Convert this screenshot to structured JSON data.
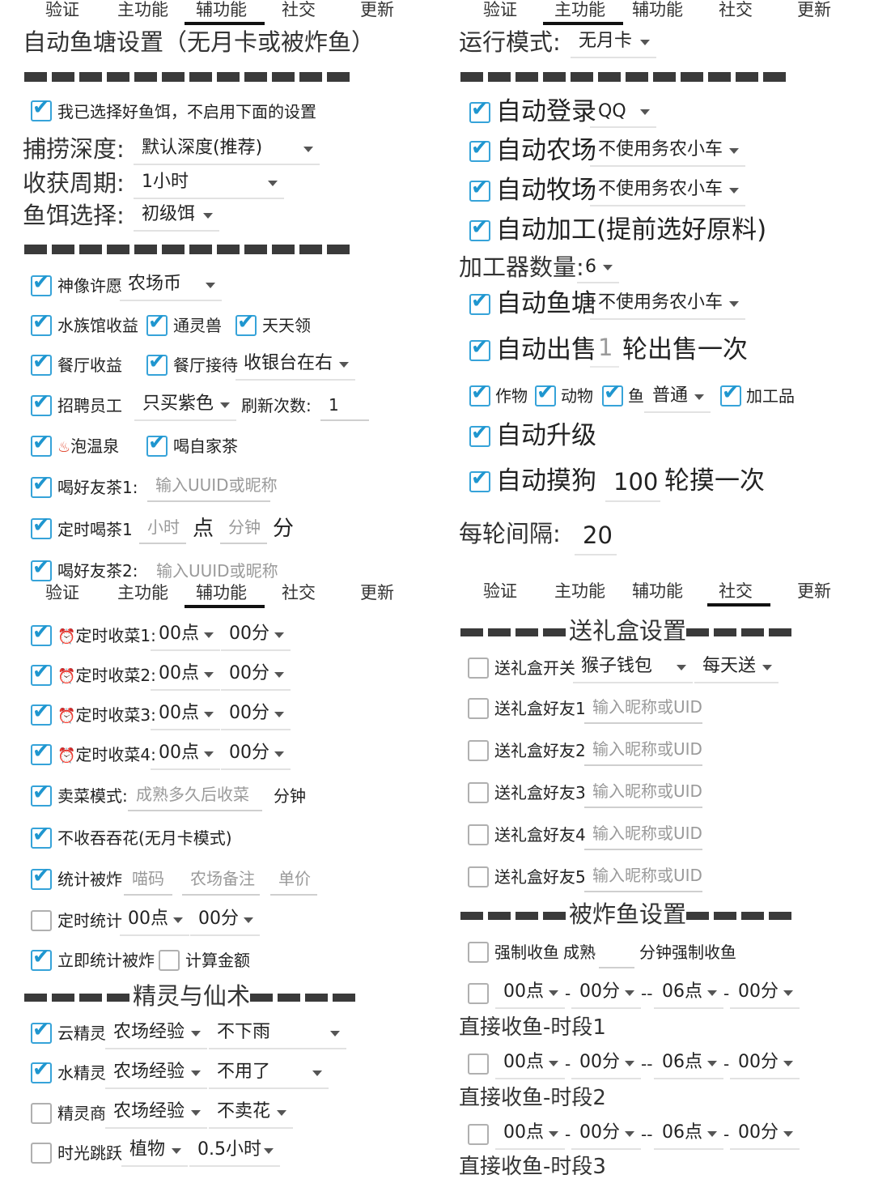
{
  "tabs": {
    "verify": "验证",
    "main": "主功能",
    "aux": "辅功能",
    "social": "社交",
    "update": "更新"
  },
  "fish": {
    "title": "自动鱼塘设置（无月卡或被炸鱼）",
    "skip_bait": "我已选择好鱼饵，不启用下面的设置",
    "depth_label": "捕捞深度:",
    "depth_value": "默认深度(推荐)",
    "cycle_label": "收获周期:",
    "cycle_value": "1小时",
    "bait_label": "鱼饵选择:",
    "bait_value": "初级饵"
  },
  "aux": {
    "wish_label": "神像许愿",
    "wish_value": "农场币",
    "aquarium": "水族馆收益",
    "spirit_beast": "通灵兽",
    "daily": "天天领",
    "restaurant": "餐厅收益",
    "reception": "餐厅接待",
    "reception_value": "收银台在右",
    "hire": "招聘员工",
    "hire_value": "只买紫色",
    "refresh_label": "刷新次数:",
    "refresh_value": "1",
    "hotspring_icon": "♨",
    "hotspring": "泡温泉",
    "own_tea": "喝自家茶",
    "friend_tea1": "喝好友茶1:",
    "friend_tea1_ph": "输入UUID或昵称",
    "timed_tea": "定时喝茶1",
    "hour_ph": "小时",
    "dian": "点",
    "minute_ph": "分钟",
    "fen": "分",
    "friend_tea2": "喝好友茶2:",
    "friend_tea2_ph": "输入UUID或昵称"
  },
  "harvest": {
    "alarm_icon": "⏰",
    "items": [
      {
        "label": "定时收菜1:",
        "hour": "00点",
        "minute": "00分"
      },
      {
        "label": "定时收菜2:",
        "hour": "00点",
        "minute": "00分"
      },
      {
        "label": "定时收菜3:",
        "hour": "00点",
        "minute": "00分"
      },
      {
        "label": "定时收菜4:",
        "hour": "00点",
        "minute": "00分"
      }
    ],
    "sell_mode": "卖菜模式:",
    "sell_ph": "成熟多久后收菜",
    "sell_unit": "分钟",
    "no_flower": "不收吞吞花(无月卡模式)",
    "stat_label": "统计被炸",
    "stat_ph1": "喵码",
    "stat_ph2": "农场备注",
    "stat_ph3": "单价",
    "timed_stat": "定时统计",
    "timed_stat_hour": "00点",
    "timed_stat_minute": "00分",
    "now_stat": "立即统计被炸",
    "calc_amount": "计算金额"
  },
  "spirit": {
    "header": "精灵与仙术",
    "cloud": "云精灵",
    "cloud_v1": "农场经验",
    "cloud_v2": "不下雨",
    "water": "水精灵",
    "water_v1": "农场经验",
    "water_v2": "不用了",
    "merchant": "精灵商",
    "merchant_v1": "农场经验",
    "merchant_v2": "不卖花",
    "jump": "时光跳跃",
    "jump_v1": "植物",
    "jump_v2": "0.5小时"
  },
  "main": {
    "mode_label": "运行模式:",
    "mode_value": "无月卡",
    "login": "自动登录",
    "login_value": "QQ",
    "farm": "自动农场",
    "farm_value": "不使用务农小车",
    "ranch": "自动牧场",
    "ranch_value": "不使用务农小车",
    "process": "自动加工(提前选好原料)",
    "processor_label": "加工器数量:",
    "processor_value": "6",
    "pond": "自动鱼塘",
    "pond_value": "不使用务农小车",
    "sell": "自动出售",
    "sell_value": "1",
    "sell_suffix": "轮出售一次",
    "crop": "作物",
    "animal": "动物",
    "fish": "鱼",
    "fish_value": "普通",
    "processed": "加工品",
    "upgrade": "自动升级",
    "dog": "自动摸狗",
    "dog_value": "100",
    "dog_suffix": "轮摸一次",
    "interval_label": "每轮间隔:",
    "interval_value": "20"
  },
  "gift": {
    "header": "送礼盒设置",
    "switch": "送礼盒开关",
    "switch_v1": "猴子钱包",
    "switch_v2": "每天送",
    "friends": [
      {
        "label": "送礼盒好友1",
        "ph": "输入昵称或UID"
      },
      {
        "label": "送礼盒好友2",
        "ph": "输入昵称或UID"
      },
      {
        "label": "送礼盒好友3",
        "ph": "输入昵称或UID"
      },
      {
        "label": "送礼盒好友4",
        "ph": "输入昵称或UID"
      },
      {
        "label": "送礼盒好友5",
        "ph": "输入昵称或UID"
      }
    ]
  },
  "bomb": {
    "header": "被炸鱼设置",
    "force": "强制收鱼",
    "force_mid": "成熟",
    "force_suffix": "分钟强制收鱼",
    "periods": [
      {
        "h1": "00点",
        "m1": "00分",
        "h2": "06点",
        "m2": "00分",
        "label": "直接收鱼-时段1"
      },
      {
        "h1": "00点",
        "m1": "00分",
        "h2": "06点",
        "m2": "00分",
        "label": "直接收鱼-时段2"
      },
      {
        "h1": "00点",
        "m1": "00分",
        "h2": "06点",
        "m2": "00分",
        "label": "直接收鱼-时段3"
      }
    ],
    "dash": "-",
    "dash2": "--"
  }
}
